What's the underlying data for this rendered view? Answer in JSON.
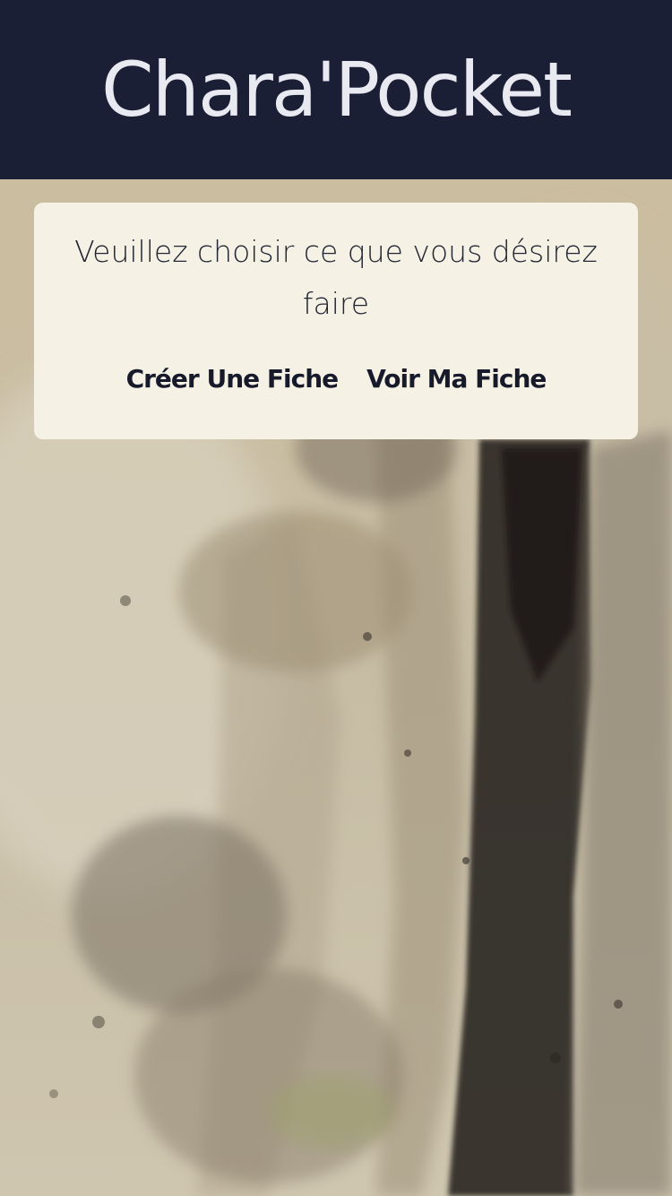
{
  "header": {
    "title": "Chara'Pocket",
    "background_color": "#1b1f36",
    "title_color": "#e8e9f1"
  },
  "background": {
    "description_icon": "watercolor-forest-background"
  },
  "card": {
    "prompt": "Veuillez choisir ce que vous désirez faire",
    "actions": [
      {
        "label": "Créer Une Fiche"
      },
      {
        "label": "Voir Ma Fiche"
      }
    ],
    "background_color": "#f5f2e5"
  }
}
